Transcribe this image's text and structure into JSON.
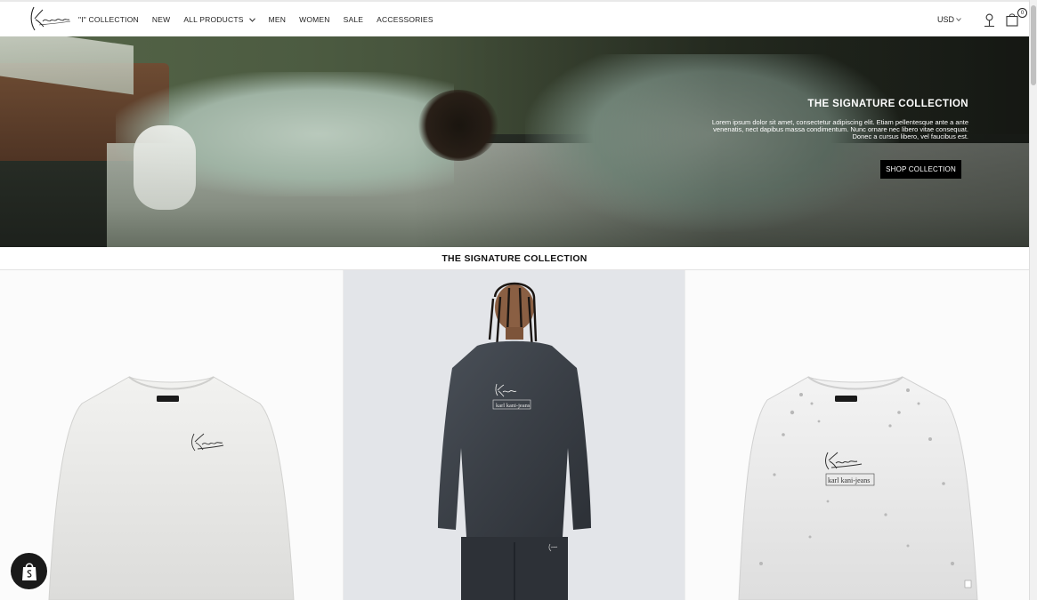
{
  "header": {
    "logo_icon": "karl-kani-signature-logo",
    "nav": [
      {
        "label": "\"I\" Collection"
      },
      {
        "label": "New"
      },
      {
        "label": "All Products",
        "has_dropdown": true
      },
      {
        "label": "Men"
      },
      {
        "label": "Women"
      },
      {
        "label": "Sale"
      },
      {
        "label": "Accessories"
      }
    ],
    "currency": "USD",
    "account_icon": "user-icon",
    "cart_icon": "shopping-bag-icon",
    "cart_count": "0"
  },
  "hero": {
    "title": "The Signature Collection",
    "body": "Lorem ipsum dolor sit amet, consectetur adipiscing elit. Etiam pellentesque ante a ante venenatis, nect dapibus massa condimentum. Nunc ornare nec libero vitae consequat. Donec a cursus libero, vel faucibus est.",
    "cta": "Shop Collection"
  },
  "section": {
    "title": "The Signature Collection"
  },
  "products": [
    {
      "image": "white-sweatshirt-signature-logo"
    },
    {
      "image": "model-washed-grey-sweatshirt"
    },
    {
      "image": "white-distressed-sweatshirt-kk-jeans-logo"
    }
  ],
  "badge_icon": "shopify-bag-icon",
  "colors": {
    "accent": "#000000",
    "text": "#222222"
  }
}
